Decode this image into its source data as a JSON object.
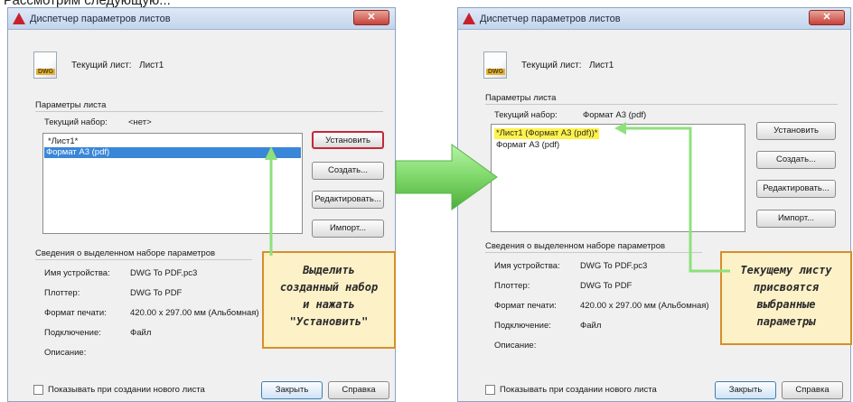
{
  "colors": {
    "red_frame": "#c4283a",
    "green_arrow": "#7fd86a",
    "selection_blue": "#3a86d8",
    "yellow_highlight": "#fff24a",
    "callout_bg": "#fdf1c8"
  },
  "top_fragment": "Рассмотрим следующую...",
  "dialog_left": {
    "title": "Диспетчер параметров листов",
    "close": "✕",
    "dwg_badge": "DWG",
    "current_sheet_label": "Текущий лист:",
    "current_sheet_value": "Лист1",
    "params_group": "Параметры листа",
    "current_set_label": "Текущий набор:",
    "current_set_value": "<нет>",
    "list_items": [
      "*Лист1*",
      "Формат А3 (pdf)"
    ],
    "buttons": {
      "set": "Установить",
      "create": "Создать...",
      "edit": "Редактировать...",
      "import": "Импорт..."
    },
    "info_group": "Сведения о выделенном наборе параметров",
    "info": {
      "device_label": "Имя устройства:",
      "device_value": "DWG To PDF.pc3",
      "plotter_label": "Плоттер:",
      "plotter_value": "DWG To PDF",
      "format_label": "Формат печати:",
      "format_value": "420.00 x 297.00 мм (Альбомная)",
      "connection_label": "Подключение:",
      "connection_value": "Файл",
      "description_label": "Описание:"
    },
    "show_on_new": "Показывать при создании нового листа",
    "close_button": "Закрыть",
    "help_button": "Справка"
  },
  "dialog_right": {
    "title": "Диспетчер параметров листов",
    "close": "✕",
    "dwg_badge": "DWG",
    "current_sheet_label": "Текущий лист:",
    "current_sheet_value": "Лист1",
    "params_group": "Параметры листа",
    "current_set_label": "Текущий набор:",
    "current_set_value": "Формат А3 (pdf)",
    "list_items": [
      "*Лист1 (Формат А3 (pdf))*",
      "Формат А3 (pdf)"
    ],
    "buttons": {
      "set": "Установить",
      "create": "Создать...",
      "edit": "Редактировать...",
      "import": "Импорт..."
    },
    "info_group": "Сведения о выделенном наборе параметров",
    "info": {
      "device_label": "Имя устройства:",
      "device_value": "DWG To PDF.pc3",
      "plotter_label": "Плоттер:",
      "plotter_value": "DWG To PDF",
      "format_label": "Формат печати:",
      "format_value": "420.00 x 297.00 мм (Альбомная)",
      "connection_label": "Подключение:",
      "connection_value": "Файл",
      "description_label": "Описание:"
    },
    "show_on_new": "Показывать при создании нового листа",
    "close_button": "Закрыть",
    "help_button": "Справка"
  },
  "callout_left": [
    "Выделить",
    "созданный набор",
    "и нажать",
    "\"Установить\""
  ],
  "callout_right": [
    "Текущему листу",
    "присвоятся",
    "выбранные",
    "параметры"
  ]
}
